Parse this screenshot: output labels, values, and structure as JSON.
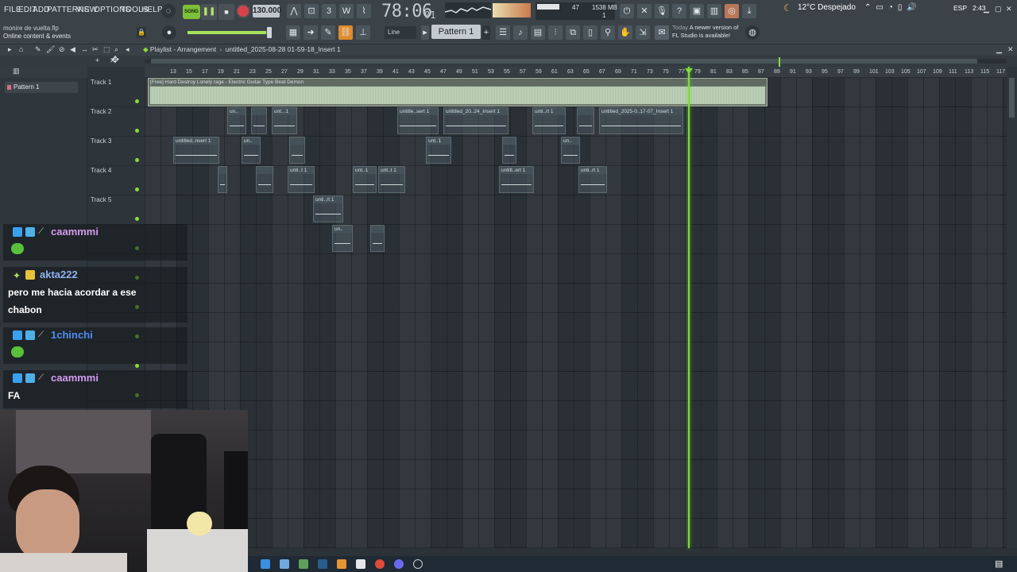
{
  "menu": [
    "FILE",
    "EDIT",
    "ADD",
    "PATTERNS",
    "VIEW",
    "OPTIONS",
    "TOOLS",
    "HELP"
  ],
  "transport": {
    "song_label": "SONG",
    "tempo": "130.000",
    "time": "78:06",
    "time_ticks": "01",
    "cpu_value": "47",
    "memory": "1538 MB",
    "polyphony": "1"
  },
  "hint": {
    "file": "monire de vuelta.flp",
    "text": "Online content & events"
  },
  "snap": "Line",
  "pattern_selector": "Pattern 1",
  "news": {
    "today": "Today",
    "line1": "A newer version of",
    "line2": "FL Studio is available!"
  },
  "playlist": {
    "window": "Playlist - Arrangement",
    "sep": "›",
    "project": "untitled_2025-08-28 01-59-18_Insert 1"
  },
  "picker": {
    "pattern": "Pattern 1"
  },
  "tracks": [
    "Track 1",
    "Track 2",
    "Track 3",
    "Track 4",
    "Track 5"
  ],
  "ruler": [
    "13",
    "15",
    "17",
    "19",
    "21",
    "23",
    "25",
    "27",
    "29",
    "31",
    "33",
    "35",
    "37",
    "39",
    "41",
    "43",
    "45",
    "47",
    "49",
    "51",
    "53",
    "55",
    "57",
    "59",
    "61",
    "63",
    "65",
    "67",
    "69",
    "71",
    "73",
    "75",
    "77",
    "79",
    "81",
    "83",
    "85",
    "87",
    "89",
    "91",
    "93",
    "95",
    "97",
    "99",
    "101",
    "103",
    "105",
    "107",
    "109",
    "111",
    "113",
    "115",
    "117"
  ],
  "audio_clip": {
    "label": "[Free] Hard Destroy Lonely rage - Electric Guitar Type Beat Demon"
  },
  "clips": [
    {
      "label": "un.."
    },
    {
      "label": ""
    },
    {
      "label": "unt...1"
    },
    {
      "label": "untitle..sert 1"
    },
    {
      "label": "untitled_20..24_Insert 1"
    },
    {
      "label": "unti..rt 1"
    },
    {
      "label": ""
    },
    {
      "label": "untitled_2025-0..17-07_Insert 1"
    },
    {
      "label": "untitled..nsert 1"
    },
    {
      "label": "un.."
    },
    {
      "label": ""
    },
    {
      "label": "unt..1"
    },
    {
      "label": ""
    },
    {
      "label": "un.."
    },
    {
      "label": ""
    },
    {
      "label": ""
    },
    {
      "label": "unti..t 1"
    },
    {
      "label": "unt..1"
    },
    {
      "label": "unt..t 1"
    },
    {
      "label": "untitl..ert 1"
    },
    {
      "label": "unti..rt 1"
    },
    {
      "label": "unti..rt 1"
    },
    {
      "label": "un.."
    },
    {
      "label": ""
    }
  ],
  "chat": [
    {
      "user": "caammmi",
      "color": "#d39cf0",
      "message": ""
    },
    {
      "user": "akta222",
      "color": "#8fb4f0",
      "message": "pero me hacia acordar a ese chabon"
    },
    {
      "user": "1chinchi",
      "color": "#4f8df0",
      "message": ""
    },
    {
      "user": "caammmi",
      "color": "#d39cf0",
      "message": "FA"
    }
  ],
  "taskbar": {
    "weather": "12°C  Despejado",
    "lang": "ESP",
    "time": "2:43"
  },
  "colors": {
    "accent_green": "#8cd93d",
    "record_red": "#d8424b",
    "background": "#2a3136"
  }
}
